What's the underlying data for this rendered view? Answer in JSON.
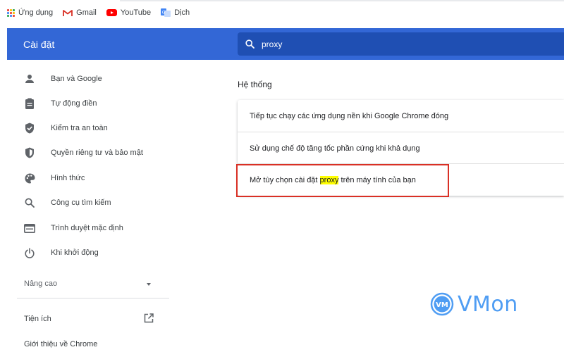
{
  "bookmarks": [
    {
      "label": "Ứng dụng",
      "icon": "apps-grid-icon"
    },
    {
      "label": "Gmail",
      "icon": "gmail-icon"
    },
    {
      "label": "YouTube",
      "icon": "youtube-icon"
    },
    {
      "label": "Dịch",
      "icon": "translate-icon"
    }
  ],
  "header": {
    "title": "Cài đặt",
    "search": {
      "value": "proxy",
      "icon": "search-icon"
    }
  },
  "sidebar": {
    "items": [
      {
        "label": "Bạn và Google",
        "icon": "person-icon"
      },
      {
        "label": "Tự động điền",
        "icon": "clipboard-icon"
      },
      {
        "label": "Kiểm tra an toàn",
        "icon": "shield-check-icon"
      },
      {
        "label": "Quyền riêng tư và bảo mật",
        "icon": "shield-icon"
      },
      {
        "label": "Hình thức",
        "icon": "palette-icon"
      },
      {
        "label": "Công cụ tìm kiếm",
        "icon": "search-icon"
      },
      {
        "label": "Trình duyệt mặc định",
        "icon": "browser-icon"
      },
      {
        "label": "Khi khởi động",
        "icon": "power-icon"
      }
    ],
    "advanced": "Nâng cao",
    "extensions": "Tiện ích",
    "about": "Giới thiệu về Chrome"
  },
  "main": {
    "section_title": "Hệ thống",
    "rows": [
      {
        "text": "Tiếp tục chạy các ứng dụng nền khi Google Chrome đóng"
      },
      {
        "text": "Sử dụng chế độ tăng tốc phần cứng khi khả dụng"
      },
      {
        "before": "Mở tùy chọn cài đặt ",
        "highlight": "proxy",
        "after": " trên máy tính của bạn"
      }
    ]
  },
  "logo": {
    "badge": "VM",
    "text": "VMon"
  },
  "colors": {
    "header_blue": "#3367d6",
    "search_bg": "#1f4fb3",
    "highlight": "#ffff00",
    "annotation_red": "#d93025",
    "logo_blue": "#4f9df3"
  }
}
